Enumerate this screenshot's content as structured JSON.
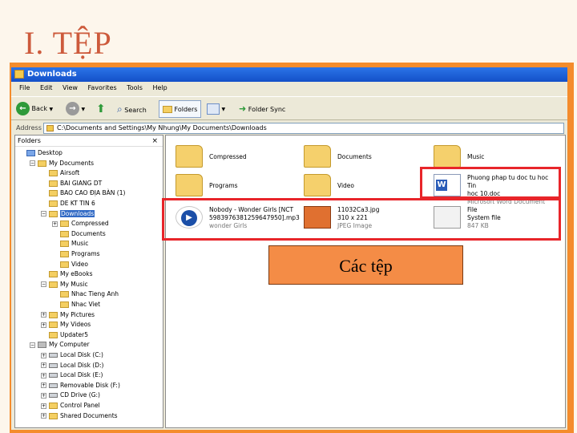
{
  "slide": {
    "title": "I. TỆP",
    "callout": "Các tệp"
  },
  "window": {
    "title": "Downloads",
    "menu": [
      "File",
      "Edit",
      "View",
      "Favorites",
      "Tools",
      "Help"
    ],
    "toolbar": {
      "back": "Back",
      "search": "Search",
      "folders": "Folders",
      "folder_sync": "Folder Sync"
    },
    "address": {
      "label": "Address",
      "path": "C:\\Documents and Settings\\My Nhung\\My Documents\\Downloads"
    },
    "folders_pane": {
      "header": "Folders",
      "close": "×",
      "tree": [
        {
          "label": "Desktop",
          "indent": 0,
          "exp": "",
          "icon": "blue"
        },
        {
          "label": "My Documents",
          "indent": 1,
          "exp": "−",
          "icon": "folder"
        },
        {
          "label": "Airsoft",
          "indent": 2,
          "exp": "",
          "icon": "folder"
        },
        {
          "label": "BAI GIANG DT",
          "indent": 2,
          "exp": "",
          "icon": "folder"
        },
        {
          "label": "BAO CAO ĐỊA BÀN (1)",
          "indent": 2,
          "exp": "",
          "icon": "folder"
        },
        {
          "label": "DE KT TIN 6",
          "indent": 2,
          "exp": "",
          "icon": "folder"
        },
        {
          "label": "Downloads",
          "indent": 2,
          "exp": "−",
          "icon": "folder",
          "selected": true
        },
        {
          "label": "Compressed",
          "indent": 3,
          "exp": "+",
          "icon": "folder"
        },
        {
          "label": "Documents",
          "indent": 3,
          "exp": "",
          "icon": "folder"
        },
        {
          "label": "Music",
          "indent": 3,
          "exp": "",
          "icon": "folder"
        },
        {
          "label": "Programs",
          "indent": 3,
          "exp": "",
          "icon": "folder"
        },
        {
          "label": "Video",
          "indent": 3,
          "exp": "",
          "icon": "folder"
        },
        {
          "label": "My eBooks",
          "indent": 2,
          "exp": "",
          "icon": "folder"
        },
        {
          "label": "My Music",
          "indent": 2,
          "exp": "−",
          "icon": "folder"
        },
        {
          "label": "Nhac Tieng Anh",
          "indent": 3,
          "exp": "",
          "icon": "folder"
        },
        {
          "label": "Nhac Viet",
          "indent": 3,
          "exp": "",
          "icon": "folder"
        },
        {
          "label": "My Pictures",
          "indent": 2,
          "exp": "+",
          "icon": "folder"
        },
        {
          "label": "My Videos",
          "indent": 2,
          "exp": "+",
          "icon": "folder"
        },
        {
          "label": "Updater5",
          "indent": 2,
          "exp": "",
          "icon": "folder"
        },
        {
          "label": "My Computer",
          "indent": 1,
          "exp": "−",
          "icon": "grey"
        },
        {
          "label": "Local Disk (C:)",
          "indent": 2,
          "exp": "+",
          "icon": "disk"
        },
        {
          "label": "Local Disk (D:)",
          "indent": 2,
          "exp": "+",
          "icon": "disk"
        },
        {
          "label": "Local Disk (E:)",
          "indent": 2,
          "exp": "+",
          "icon": "disk"
        },
        {
          "label": "Removable Disk (F:)",
          "indent": 2,
          "exp": "+",
          "icon": "disk"
        },
        {
          "label": "CD Drive (G:)",
          "indent": 2,
          "exp": "+",
          "icon": "disk"
        },
        {
          "label": "Control Panel",
          "indent": 2,
          "exp": "+",
          "icon": "folder"
        },
        {
          "label": "Shared Documents",
          "indent": 2,
          "exp": "+",
          "icon": "folder"
        }
      ]
    },
    "items": [
      {
        "name": "Compressed",
        "line2": "",
        "line3": "",
        "kind": "folder"
      },
      {
        "name": "Documents",
        "line2": "",
        "line3": "",
        "kind": "folder"
      },
      {
        "name": "Music",
        "line2": "",
        "line3": "",
        "kind": "folder"
      },
      {
        "name": "Programs",
        "line2": "",
        "line3": "",
        "kind": "folder"
      },
      {
        "name": "Video",
        "line2": "",
        "line3": "",
        "kind": "folder"
      },
      {
        "name": "Phuong phap tu doc tu hoc Tin",
        "line2": "hoc 10.doc",
        "line3": "Microsoft Word Document",
        "kind": "doc"
      },
      {
        "name": "Nobody - Wonder Girls [NCT",
        "line2": "5983976381259647950].mp3",
        "line3": "wonder Girls",
        "kind": "media"
      },
      {
        "name": "11032Ca3.jpg",
        "line2": "310 x 221",
        "line3": "JPEG Image",
        "kind": "jpg"
      },
      {
        "name": "File",
        "line2": "System file",
        "line3": "847 KB",
        "kind": "sys"
      }
    ]
  }
}
